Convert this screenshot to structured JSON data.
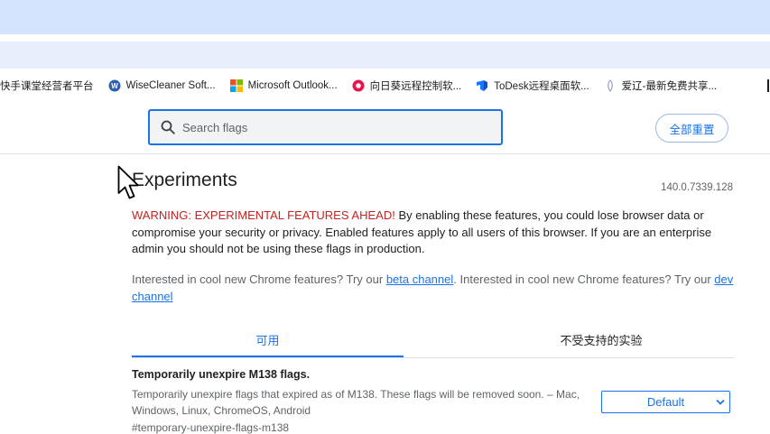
{
  "bookmarks": [
    {
      "label": "快手课堂经营者平台",
      "icon": "none"
    },
    {
      "label": "WiseCleaner Soft...",
      "icon": "wisecleaner-icon"
    },
    {
      "label": "Microsoft Outlook...",
      "icon": "microsoft-icon"
    },
    {
      "label": "向日葵远程控制软...",
      "icon": "sunlogin-icon"
    },
    {
      "label": "ToDesk远程桌面软...",
      "icon": "todesk-icon"
    },
    {
      "label": "爱辽-最新免费共享...",
      "icon": "aiyou-icon"
    }
  ],
  "header": {
    "search_placeholder": "Search flags",
    "reset_label": "全部重置"
  },
  "main": {
    "title": "Experiments",
    "version": "140.0.7339.128",
    "warning_red": "WARNING: EXPERIMENTAL FEATURES AHEAD!",
    "warning_rest": " By enabling these features, you could lose browser data or compromise your security or privacy. Enabled features apply to all users of this browser. If you are an enterprise admin you should not be using these flags in production.",
    "intro_part1": "Interested in cool new Chrome features? Try our ",
    "beta_link": "beta channel",
    "intro_part2": ". Interested in cool new Chrome features? Try our ",
    "dev_link": "dev channel"
  },
  "tabs": {
    "available": "可用",
    "unavailable": "不受支持的实验"
  },
  "flag": {
    "title": "Temporarily unexpire M138 flags.",
    "description": "Temporarily unexpire flags that expired as of M138. These flags will be removed soon. – Mac, Windows, Linux, ChromeOS, Android",
    "id": "#temporary-unexpire-flags-m138",
    "selected_option": "Default"
  },
  "colors": {
    "accent": "#1a73e8",
    "warning": "#c5221f",
    "tabstrip": "#d3e3fd"
  }
}
